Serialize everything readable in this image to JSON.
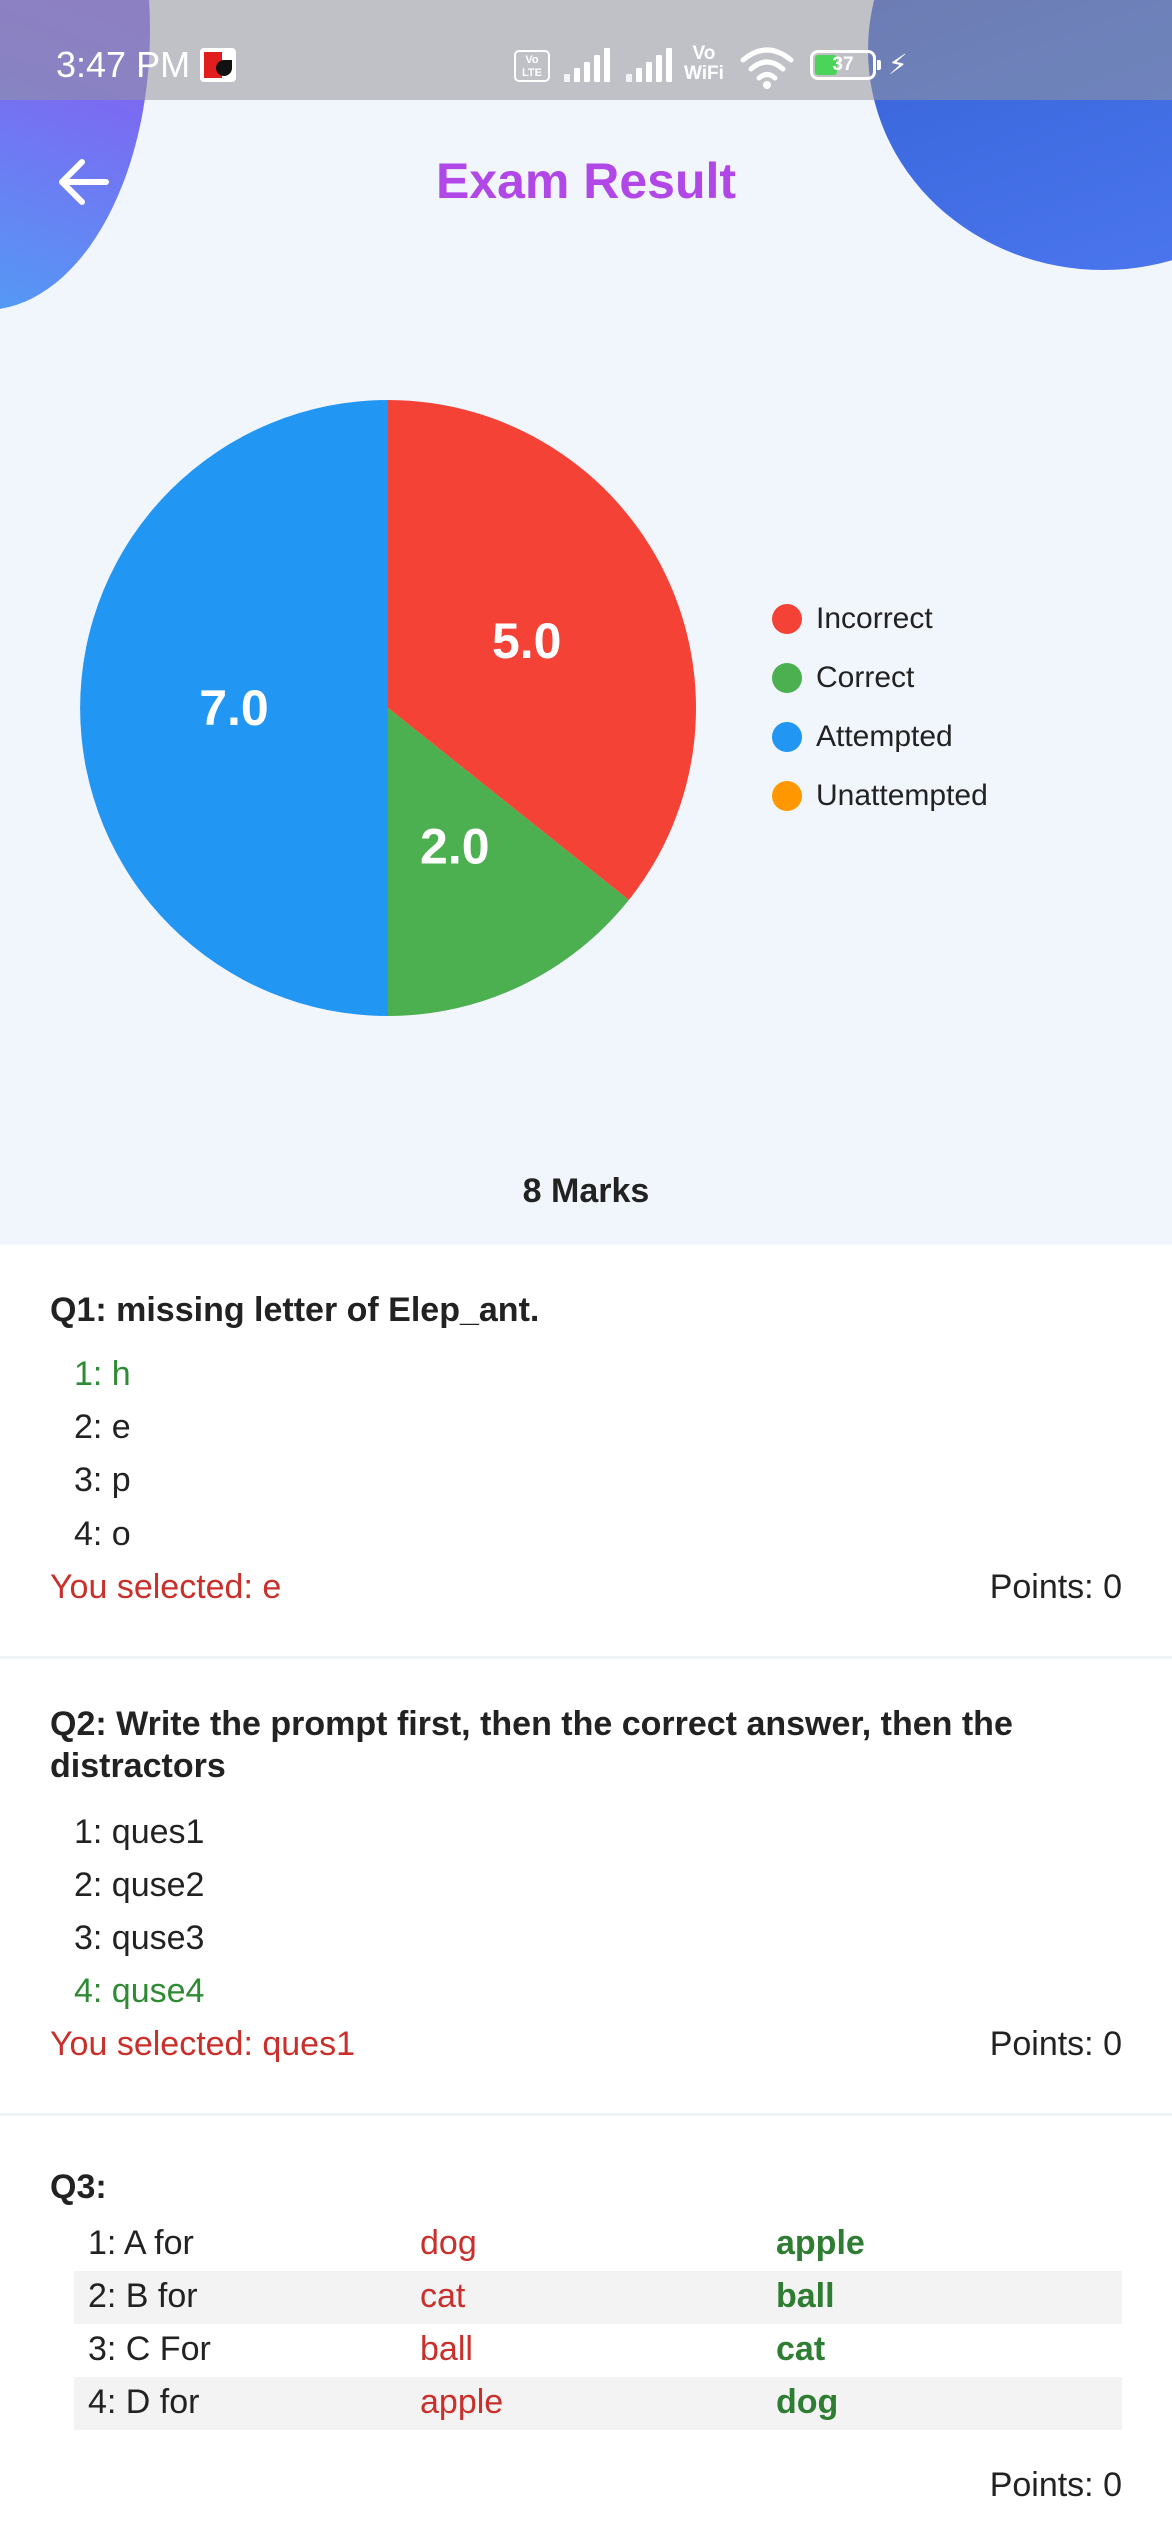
{
  "status_bar": {
    "time": "3:47 PM",
    "volte_label": "Vo LTE",
    "vowifi_label": "Vo WiFi",
    "battery_level": "37"
  },
  "header": {
    "title": "Exam Result"
  },
  "chart_data": {
    "type": "pie",
    "slices": [
      {
        "label": "Incorrect",
        "value": 5.0,
        "value_label": "5.0",
        "color": "#f44336"
      },
      {
        "label": "Correct",
        "value": 2.0,
        "value_label": "2.0",
        "color": "#4caf50"
      },
      {
        "label": "Attempted",
        "value": 7.0,
        "value_label": "7.0",
        "color": "#2196f3"
      },
      {
        "label": "Unattempted",
        "value": 0,
        "value_label": "",
        "color": "#ff9800"
      }
    ],
    "legend_position": "right"
  },
  "summary": {
    "marks": "8 Marks"
  },
  "questions": [
    {
      "title": "Q1: missing letter of Elep_ant.",
      "options": [
        "1: h",
        "2: e",
        "3: p",
        "4: o"
      ],
      "correct_index": 0,
      "selected_text": "You selected: e",
      "points_text": "Points: 0"
    },
    {
      "title": "Q2: Write the prompt first, then the correct answer, then the distractors",
      "options": [
        "1: ques1",
        "2: quse2",
        "3: quse3",
        "4: quse4"
      ],
      "correct_index": 3,
      "selected_text": "You selected: ques1",
      "points_text": "Points: 0"
    },
    {
      "title": "Q3:",
      "match_rows": [
        {
          "prompt": "1: A for",
          "selected": "dog",
          "correct": "apple"
        },
        {
          "prompt": "2: B for",
          "selected": "cat",
          "correct": "ball"
        },
        {
          "prompt": "3: C For",
          "selected": "ball",
          "correct": "cat"
        },
        {
          "prompt": "4: D for",
          "selected": "apple",
          "correct": "dog"
        }
      ],
      "points_text": "Points: 0"
    }
  ],
  "icons": {
    "back": "arrow-left-icon",
    "wifi": "wifi-icon",
    "battery": "battery-icon",
    "charging": "charging-bolt-icon"
  }
}
